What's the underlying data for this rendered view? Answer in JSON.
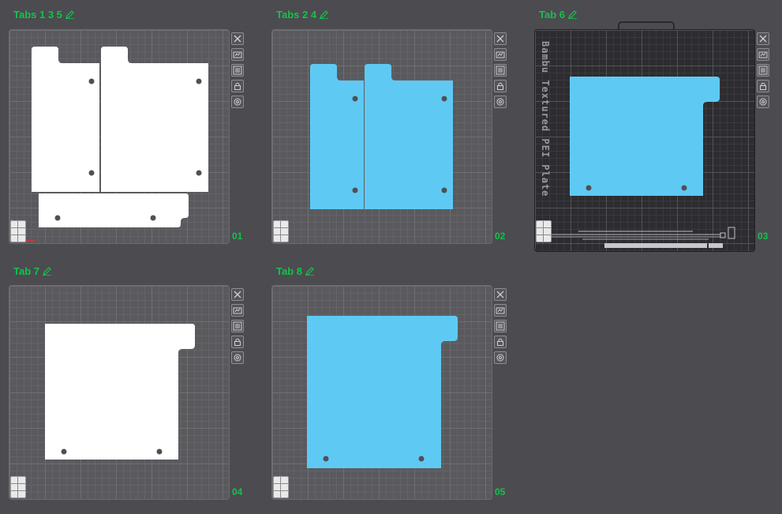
{
  "colors": {
    "accent": "#14c24b",
    "part_white": "#ffffff",
    "part_blue": "#5ecaf4"
  },
  "icons": [
    "close-icon",
    "auto-orient-icon",
    "arrange-icon",
    "lock-icon",
    "settings-icon",
    "edit-icon",
    "grid-icon"
  ],
  "plates": [
    {
      "title": "Tabs 1 3 5",
      "number": "01"
    },
    {
      "title": "Tabs 2 4",
      "number": "02"
    },
    {
      "title": "Tab 6",
      "number": "03",
      "bed_label": "Bambu Textured PEI Plate"
    },
    {
      "title": "Tab 7",
      "number": "04"
    },
    {
      "title": "Tab 8",
      "number": "05"
    }
  ]
}
